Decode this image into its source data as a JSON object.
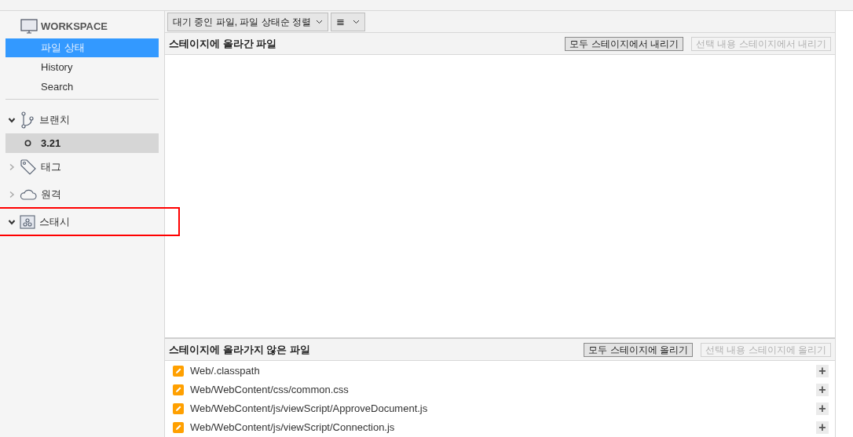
{
  "sidebar": {
    "workspace": {
      "title": "WORKSPACE",
      "items": [
        {
          "label": "파일 상태",
          "selected": true
        },
        {
          "label": "History",
          "selected": false
        },
        {
          "label": "Search",
          "selected": false
        }
      ]
    },
    "sections": [
      {
        "kind": "branch",
        "label": "브랜치",
        "expanded": true,
        "highlighted": false,
        "children": [
          {
            "label": "3.21",
            "current": true,
            "selected": true
          }
        ]
      },
      {
        "kind": "tag",
        "label": "태그",
        "expanded": false,
        "highlighted": false
      },
      {
        "kind": "remote",
        "label": "원격",
        "expanded": false,
        "highlighted": false
      },
      {
        "kind": "stash",
        "label": "스태시",
        "expanded": true,
        "highlighted": true
      }
    ]
  },
  "toolbar": {
    "sort_dropdown": "대기 중인 파일, 파일 상태순 정렬",
    "view_dropdown": "≣"
  },
  "staged": {
    "title": "스테이지에 올라간 파일",
    "buttons": [
      {
        "label": "모두 스테이지에서 내리기",
        "disabled": false
      },
      {
        "label": "선택 내용 스테이지에서 내리기",
        "disabled": true
      }
    ]
  },
  "unstaged": {
    "title": "스테이지에 올라가지 않은 파일",
    "buttons": [
      {
        "label": "모두 스테이지에 올리기",
        "disabled": false
      },
      {
        "label": "선택 내용 스테이지에 올리기",
        "disabled": true
      }
    ],
    "files": [
      {
        "path": "Web/.classpath",
        "action": "+"
      },
      {
        "path": "Web/WebContent/css/common.css",
        "action": "+"
      },
      {
        "path": "Web/WebContent/js/viewScript/ApproveDocument.js",
        "action": "+"
      },
      {
        "path": "Web/WebContent/js/viewScript/Connection.js",
        "action": "+"
      }
    ]
  }
}
